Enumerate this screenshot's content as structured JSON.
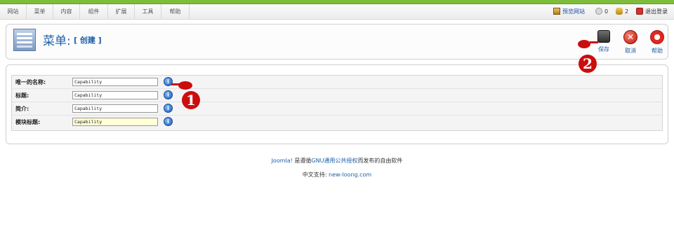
{
  "menu": {
    "items": [
      "网站",
      "菜单",
      "内容",
      "组件",
      "扩展",
      "工具",
      "帮助"
    ]
  },
  "status": {
    "preview": "预览网站",
    "messages_count": "0",
    "users_count": "2",
    "logout": "退出登录"
  },
  "header": {
    "title": "菜单:",
    "subtitle": "[ 创建 ]"
  },
  "toolbar": {
    "save": "保存",
    "cancel": "取消",
    "help": "帮助"
  },
  "form": {
    "fields": [
      {
        "label": "唯一的名称:",
        "value": "Capability"
      },
      {
        "label": "标题:",
        "value": "Capability"
      },
      {
        "label": "简介:",
        "value": "Capability"
      },
      {
        "label": "模块标题:",
        "value": "Capability"
      }
    ]
  },
  "annotations": {
    "first": "1",
    "second": "2"
  },
  "footer": {
    "line1_link": "Joomla!",
    "line1_mid": " 是遵循",
    "line1_link2": "GNU通用公共授权",
    "line1_end": "而发布的自由软件",
    "line2_label": "中文支持:",
    "line2_link": "new-loong.com"
  },
  "colors": {
    "accent_green": "#7ebd3a",
    "link_blue": "#1f5fa8",
    "annotation_red": "#cc0d0d"
  }
}
